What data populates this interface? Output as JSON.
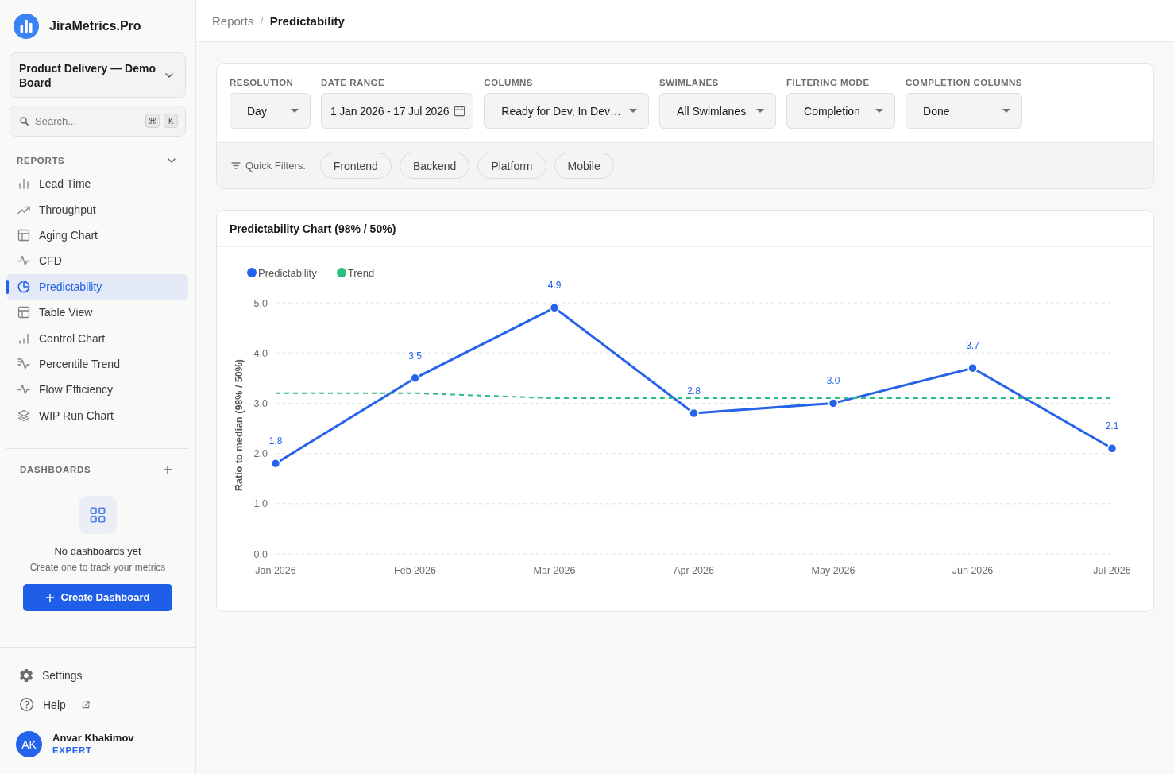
{
  "sidebar": {
    "app_name": "JiraMetrics.Pro",
    "board_selector": {
      "value": "Product Delivery — Demo Board"
    },
    "search": {
      "placeholder": "Search...",
      "shortcut": [
        "⌘",
        "K"
      ]
    },
    "reports": {
      "title": "REPORTS",
      "expanded": true,
      "items": [
        {
          "label": "Lead Time",
          "selected": false
        },
        {
          "label": "Throughput",
          "selected": false
        },
        {
          "label": "Aging Chart",
          "selected": false
        },
        {
          "label": "CFD",
          "selected": false
        },
        {
          "label": "Predictability",
          "selected": true
        },
        {
          "label": "Table View",
          "selected": false
        },
        {
          "label": "Control Chart",
          "selected": false
        },
        {
          "label": "Percentile Trend",
          "selected": false
        },
        {
          "label": "Flow Efficiency",
          "selected": false
        },
        {
          "label": "WIP Run Chart",
          "selected": false
        }
      ]
    },
    "dashboards": {
      "title": "DASHBOARDS",
      "empty_title": "No dashboards yet",
      "empty_text": "Create one to track your metrics",
      "create_button": "Create Dashboard"
    },
    "footer_links": [
      {
        "label": "Settings",
        "external": false
      },
      {
        "label": "Help",
        "external": true
      }
    ],
    "user": {
      "initials": "AK",
      "name": "Anvar Khakimov",
      "role": "EXPERT"
    }
  },
  "breadcrumb": {
    "separator": "/",
    "items": [
      {
        "label": "Reports",
        "current": false
      },
      {
        "label": "Predictability",
        "current": true
      }
    ]
  },
  "filters": [
    {
      "label": "RESOLUTION",
      "value": "Day",
      "kind": "dropdown"
    },
    {
      "label": "DATE RANGE",
      "value": "1 Jan 2026 - 17 Jul 2026",
      "kind": "date"
    },
    {
      "label": "COLUMNS",
      "value": "Ready for Dev, In Dev…",
      "kind": "dropdown"
    },
    {
      "label": "SWIMLANES",
      "value": "All Swimlanes",
      "kind": "dropdown"
    },
    {
      "label": "FILTERING MODE",
      "value": "Completion",
      "kind": "dropdown"
    },
    {
      "label": "COMPLETION COLUMNS",
      "value": "Done",
      "kind": "dropdown"
    }
  ],
  "quick_filters": {
    "label": "Quick Filters:",
    "chips": [
      {
        "label": "Frontend",
        "selected": false
      },
      {
        "label": "Backend",
        "selected": false
      },
      {
        "label": "Platform",
        "selected": false
      },
      {
        "label": "Mobile",
        "selected": false
      }
    ]
  },
  "chart": {
    "chart_data": {
      "type": "line",
      "title": "Predictability Chart (98% / 50%)",
      "ylabel": "Ratio to median (98% / 50%)",
      "legend": "top-left",
      "grid": "y",
      "categories": [
        "Jan 2026",
        "Feb 2026",
        "Mar 2026",
        "Apr 2026",
        "May 2026",
        "Jun 2026",
        "Jul 2026"
      ],
      "series": [
        {
          "name": "Predictability",
          "color": "#2563eb",
          "line_style": "solid",
          "marker": "circle",
          "values": [
            1.8,
            3.5,
            4.9,
            2.8,
            3.0,
            3.7,
            2.1
          ],
          "value_labels": [
            "1.8",
            "3.5",
            "4.9",
            "2.8",
            "3.0",
            "3.7",
            "2.1"
          ]
        },
        {
          "name": "Trend",
          "color": "#2bbd7e",
          "line_style": "dashed",
          "values": [
            3.2,
            3.2,
            3.1,
            3.1,
            3.1,
            3.1,
            3.1
          ]
        }
      ],
      "ylim": [
        0,
        5
      ],
      "yticks": [
        {
          "value": 0,
          "label": "0.0"
        },
        {
          "value": 1,
          "label": "1.0"
        },
        {
          "value": 2,
          "label": "2.0"
        },
        {
          "value": 3,
          "label": "3.0"
        },
        {
          "value": 4,
          "label": "4.0"
        },
        {
          "value": 5,
          "label": "5.0"
        }
      ]
    }
  }
}
